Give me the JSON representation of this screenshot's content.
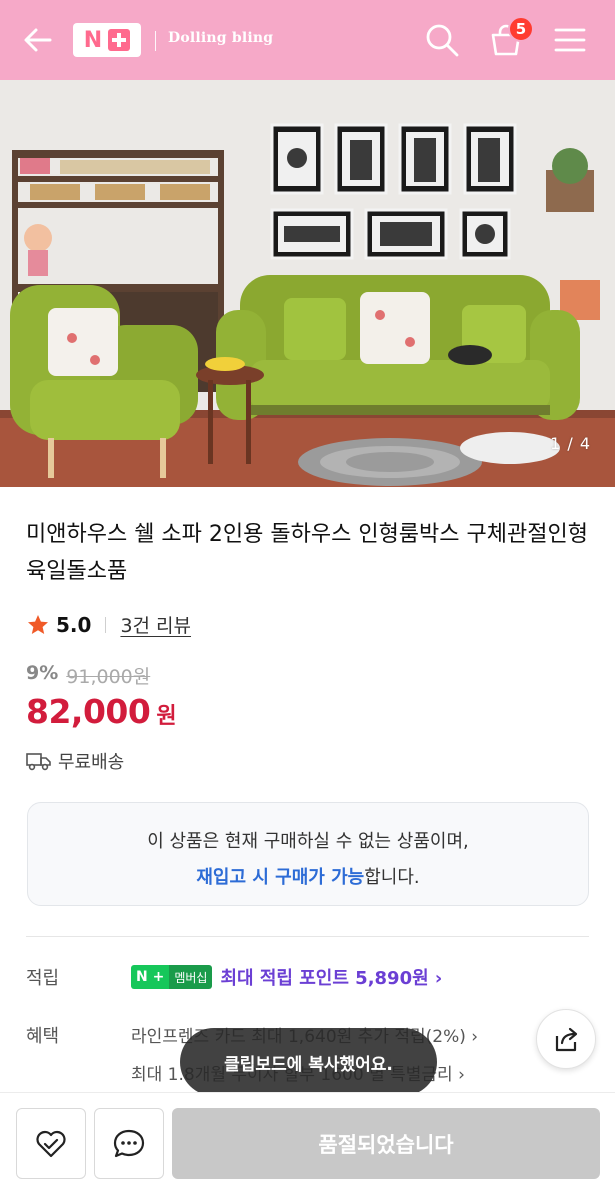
{
  "header": {
    "logo_text": "N+",
    "brand": "Dolling bling",
    "cart_count": "5",
    "bg_color": "#f6a9c8",
    "icons": [
      "arrow-left-icon",
      "search-icon",
      "shopping-bag-icon",
      "hamburger-menu-icon"
    ]
  },
  "gallery": {
    "counter": "1 / 4"
  },
  "product": {
    "title": "미앤하우스 쉘 소파 2인용 돌하우스 인형룸박스 구체관절인형 육일돌소품",
    "rating": "5.0",
    "reviews": "3건 리뷰",
    "discount_pct": "9%",
    "original_price": "91,000원",
    "price": "82,000",
    "price_unit": "원",
    "shipping": "무료배송"
  },
  "notice": {
    "line1": "이 상품은 현재 구매하실 수 없는 상품이며,",
    "line2_highlight": "재입고 시 구매가 가능",
    "line2_rest": "합니다."
  },
  "details": {
    "points_label": "적립",
    "npay_mark": "N +",
    "npay_member": "멤버십",
    "points_text": "최대 적립 포인트 5,890원 ›",
    "benefit_label": "혜택",
    "benefit_line1": "라인프렌즈 카드 최대 1,640원 추가 적립(2%) ›",
    "benefit_line2": "최대 1.8개월 무이자 할부 1600 별 특별금리 ›"
  },
  "toast": {
    "text": "클립보드에 복사했어요."
  },
  "actions": {
    "soldout": "품절되었습니다"
  },
  "colors": {
    "price_red": "#d21c3c",
    "link_blue": "#2d6cd6",
    "points_purple": "#6b3fd4",
    "npay_green": "#16c75a"
  }
}
